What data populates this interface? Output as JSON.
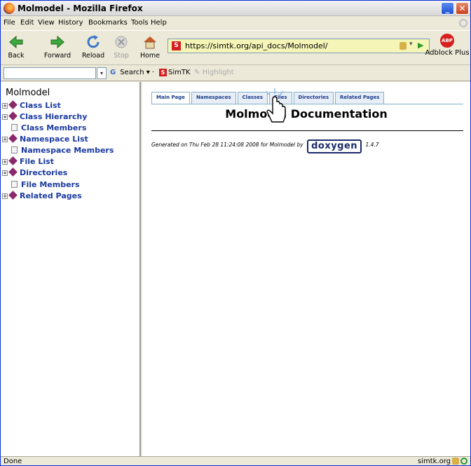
{
  "window": {
    "title": "Molmodel - Mozilla Firefox"
  },
  "menu": [
    "File",
    "Edit",
    "View",
    "History",
    "Bookmarks",
    "Tools",
    "Help"
  ],
  "toolbar": {
    "back_label": "Back",
    "forward_label": "Forward",
    "reload_label": "Reload",
    "stop_label": "Stop",
    "home_label": "Home",
    "url": "https://simtk.org/api_docs/Molmodel/",
    "adblock_label": "Adblock Plus",
    "adblock_badge": "ABP"
  },
  "search_toolbar": {
    "search_label": "Search",
    "simtk_label": "SimTK",
    "highlight_label": "Highlight"
  },
  "sidebar": {
    "title": "Molmodel",
    "items": [
      {
        "label": "Class List",
        "kind": "folder"
      },
      {
        "label": "Class Hierarchy",
        "kind": "folder"
      },
      {
        "label": "Class Members",
        "kind": "page"
      },
      {
        "label": "Namespace List",
        "kind": "folder"
      },
      {
        "label": "Namespace Members",
        "kind": "page"
      },
      {
        "label": "File List",
        "kind": "folder"
      },
      {
        "label": "Directories",
        "kind": "folder"
      },
      {
        "label": "File Members",
        "kind": "page"
      },
      {
        "label": "Related Pages",
        "kind": "folder"
      }
    ]
  },
  "content": {
    "tabs": [
      "Main Page",
      "Namespaces",
      "Classes",
      "Files",
      "Directories",
      "Related Pages"
    ],
    "current_tab": "Main Page",
    "title": "Molmodel Documentation",
    "generated_prefix": "Generated on Thu Feb 28 11:24:08 2008 for Molmodel by",
    "doxygen_logo": "doxygen",
    "doxygen_version": "1.4.7"
  },
  "status": {
    "left": "Done",
    "host": "simtk.org"
  },
  "colors": {
    "link": "#1a3aa0",
    "tab_border": "#84b0c7",
    "url_bg": "#f5f5b8"
  }
}
